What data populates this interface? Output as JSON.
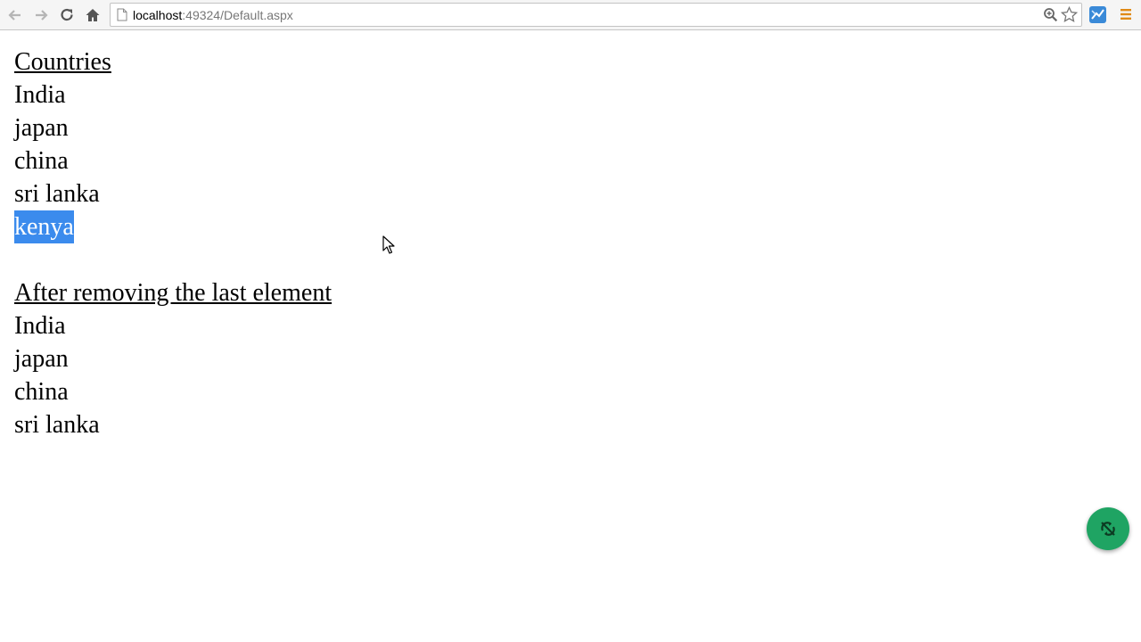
{
  "browser": {
    "url_host": "localhost",
    "url_rest": ":49324/Default.aspx",
    "icons": {
      "back": "arrow-left-icon",
      "forward": "arrow-right-icon",
      "reload": "reload-icon",
      "home": "home-icon",
      "page": "page-icon",
      "zoom": "magnifier-icon",
      "bookmark": "star-icon",
      "extension": "extension-icon",
      "menu": "hamburger-icon"
    }
  },
  "page": {
    "list_heading": "Countries",
    "countries": [
      "India",
      "japan",
      "china",
      "sri lanka",
      "kenya"
    ],
    "result_heading": "After removing the last element",
    "remaining": [
      "India",
      "japan",
      "china",
      "sri lanka"
    ],
    "selection_color": "#3b8bed"
  },
  "fab": {
    "icon": "sync-off-icon",
    "color": "#1fa463"
  }
}
